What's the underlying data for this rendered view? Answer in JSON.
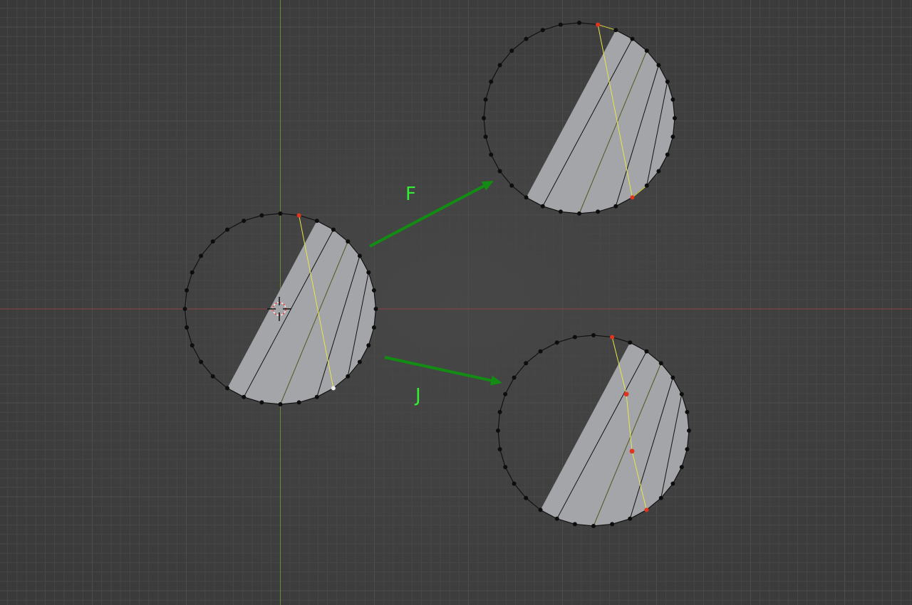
{
  "viewport": {
    "background_color": "#3f3f3f",
    "grid_minor_color": "#474747",
    "grid_major_color": "#4d4d4d",
    "x_axis_color": "#8a4444",
    "y_axis_color": "#6a8a3a"
  },
  "arrows": {
    "color": "#128c12",
    "label_color": "#33ee33",
    "fill_label": "F",
    "join_label": "J"
  },
  "mesh": {
    "face_color": "#a3a5a8",
    "wire_color": "#111111",
    "vertex_color": "#0d0d0d",
    "selected_edge_color": "#e8e84a",
    "selected_vertex_color": "#e2341e",
    "active_vertex_color": "#ececec"
  },
  "cursor": {
    "icon": "3d-cursor-icon"
  }
}
